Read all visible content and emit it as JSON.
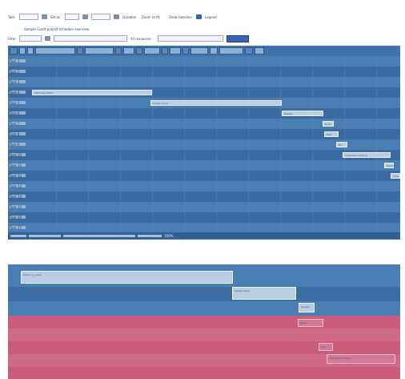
{
  "header": {
    "row1": [
      "Task",
      "Scheduling",
      "Set as",
      "Dependency",
      "Milestone",
      "Lag",
      "Duration",
      "Zoom to fit",
      "Show baseline",
      "Legend"
    ],
    "row2_title": "Sample Gantt project schedule overview",
    "row3": [
      "Filter",
      "Task name",
      "All resources",
      "Apply"
    ]
  },
  "toolbar": {
    "buttons": 18
  },
  "rows": [
    {
      "label": "Task 1"
    },
    {
      "label": "Task 2"
    },
    {
      "label": "Task 3"
    },
    {
      "label": "Task 4"
    },
    {
      "label": "Task 5"
    },
    {
      "label": "Task 6"
    },
    {
      "label": "Task 7"
    },
    {
      "label": "Task 8"
    },
    {
      "label": "Task 9"
    },
    {
      "label": "Task 10"
    },
    {
      "label": "Task 11"
    },
    {
      "label": "Task 12"
    },
    {
      "label": "Task 13"
    },
    {
      "label": "Task 14"
    },
    {
      "label": "Task 15"
    },
    {
      "label": "Task 16"
    },
    {
      "label": "Task 17"
    }
  ],
  "bars": [
    {
      "label": "Planning phase"
    },
    {
      "label": "Design work"
    },
    {
      "label": "Review"
    },
    {
      "label": "Build"
    },
    {
      "label": "Test"
    },
    {
      "label": "Fix"
    },
    {
      "label": "Integration testing"
    },
    {
      "label": "Deploy"
    },
    {
      "label": "Close"
    }
  ],
  "status": {
    "zoom": "100%"
  },
  "zoom_bars": [
    {
      "label": "Planning phase"
    },
    {
      "label": "Design work"
    },
    {
      "label": "Review"
    },
    {
      "label": "Build"
    },
    {
      "label": "Test"
    },
    {
      "label": "Integration testing"
    }
  ]
}
